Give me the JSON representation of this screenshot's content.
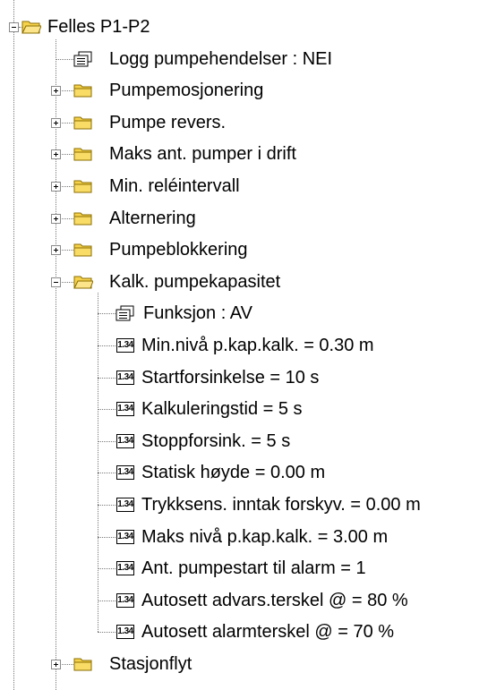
{
  "tree": {
    "root": {
      "label": "Felles P1-P2",
      "expanded": true
    },
    "items": [
      {
        "label": "Logg pumpehendelser : NEI",
        "icon": "list-icon"
      },
      {
        "label": "Pumpemosjonering",
        "icon": "folder-icon",
        "expanded": false
      },
      {
        "label": "Pumpe revers.",
        "icon": "folder-icon",
        "expanded": false
      },
      {
        "label": "Maks ant. pumper i drift",
        "icon": "folder-icon",
        "expanded": false
      },
      {
        "label": "Min. reléintervall",
        "icon": "folder-icon",
        "expanded": false
      },
      {
        "label": "Alternering",
        "icon": "folder-icon",
        "expanded": false
      },
      {
        "label": "Pumpeblokkering",
        "icon": "folder-icon",
        "expanded": false
      },
      {
        "label": "Kalk. pumpekapasitet",
        "icon": "folder-open-icon",
        "expanded": true,
        "children": [
          {
            "label": "Funksjon : AV",
            "icon": "list-icon"
          },
          {
            "label": "Min.nivå p.kap.kalk. = 0.30 m",
            "icon": "numeric-icon"
          },
          {
            "label": "Startforsinkelse = 10 s",
            "icon": "numeric-icon"
          },
          {
            "label": "Kalkuleringstid = 5 s",
            "icon": "numeric-icon"
          },
          {
            "label": "Stoppforsink. = 5 s",
            "icon": "numeric-icon"
          },
          {
            "label": "Statisk høyde = 0.00 m",
            "icon": "numeric-icon"
          },
          {
            "label": "Trykksens. inntak forskyv. = 0.00 m",
            "icon": "numeric-icon"
          },
          {
            "label": "Maks nivå p.kap.kalk. = 3.00 m",
            "icon": "numeric-icon"
          },
          {
            "label": "Ant. pumpestart til alarm = 1",
            "icon": "numeric-icon"
          },
          {
            "label": "Autosett advars.terskel @ = 80 %",
            "icon": "numeric-icon"
          },
          {
            "label": "Autosett alarmterskel @ = 70 %",
            "icon": "numeric-icon"
          }
        ]
      },
      {
        "label": "Stasjonflyt",
        "icon": "folder-icon",
        "expanded": false
      }
    ],
    "numeric_icon_text": "1.34"
  },
  "colors": {
    "folder_fill": "#f6d24a",
    "folder_edge": "#8a6d00",
    "connector": "#7a7a7a"
  }
}
